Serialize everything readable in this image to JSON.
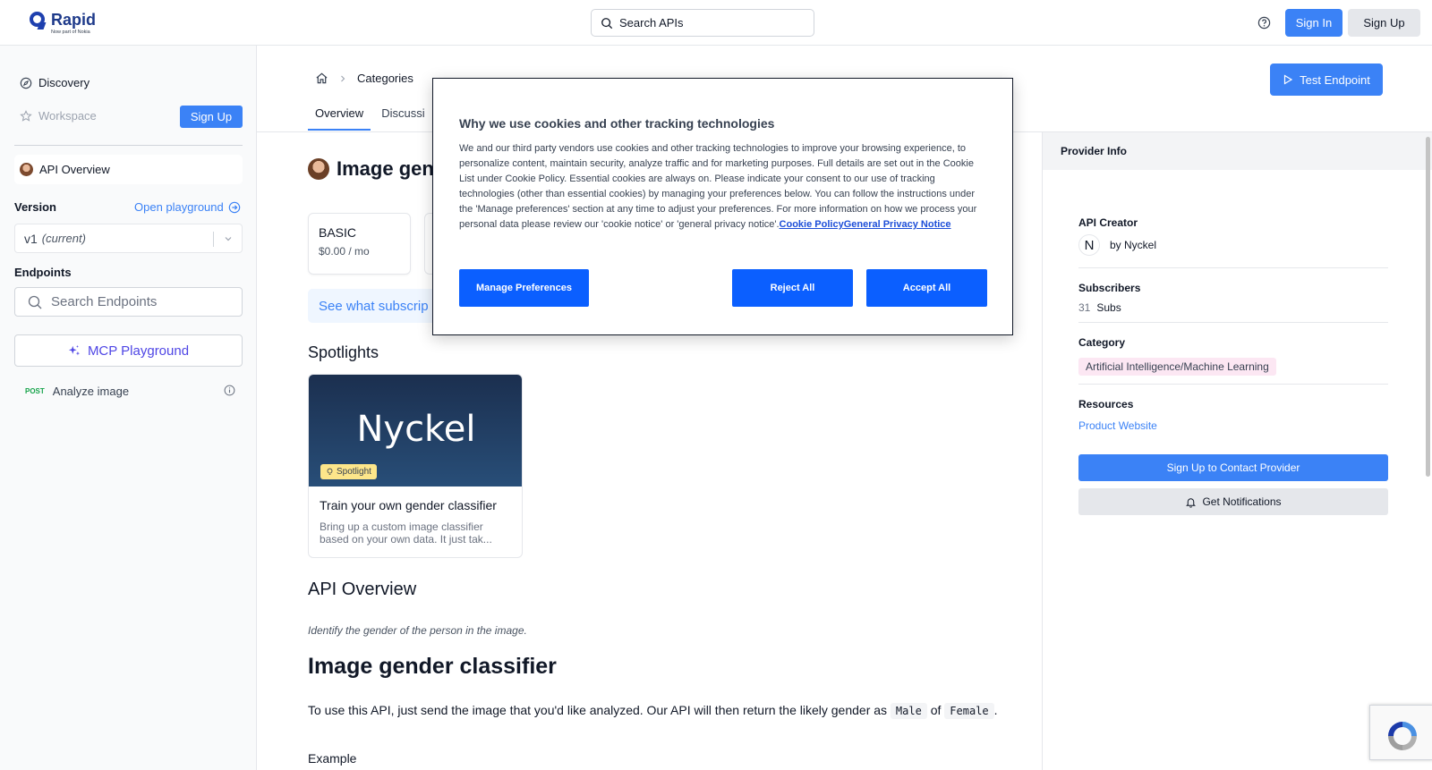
{
  "header": {
    "logo_name": "Rapid",
    "logo_sub": "Now part of Nokia",
    "search_placeholder": "Search APIs",
    "sign_in": "Sign In",
    "sign_up": "Sign Up"
  },
  "sidebar": {
    "discovery": "Discovery",
    "workspace": "Workspace",
    "sign_up": "Sign Up",
    "api_overview": "API Overview",
    "version_label": "Version",
    "open_playground": "Open playground",
    "version_value": "v1",
    "version_note": "(current)",
    "endpoints_label": "Endpoints",
    "endpoint_search_placeholder": "Search Endpoints",
    "mcp_playground": "MCP Playground",
    "endpoints": [
      {
        "method": "POST",
        "name": "Analyze image"
      }
    ]
  },
  "main": {
    "breadcrumb": [
      "Categories"
    ],
    "tabs": [
      "Overview",
      "Discussi"
    ],
    "test_endpoint": "Test Endpoint",
    "api_title": "Image gen",
    "plan": {
      "name": "BASIC",
      "price": "$0.00 / mo"
    },
    "subscription_banner": "See what subscrip",
    "spotlights_heading": "Spotlights",
    "spotlight": {
      "logo_text": "Nyckel",
      "badge": "Spotlight",
      "title": "Train your own gender classifier",
      "desc": "Bring up a custom image classifier based on your own data. It just tak..."
    },
    "overview_heading": "API Overview",
    "overview_desc": "Identify the gender of the person in the image.",
    "classifier_heading": "Image gender classifier",
    "usage_prefix": "To use this API, just send the image that you'd like analyzed. Our API will then return the likely gender as",
    "usage_male": "Male",
    "usage_of": "of",
    "usage_female": "Female",
    "usage_suffix": ".",
    "example_label": "Example"
  },
  "provider": {
    "header": "Provider Info",
    "api_creator_label": "API Creator",
    "creator_initial": "N",
    "creator_name": "by Nyckel",
    "subscribers_label": "Subscribers",
    "subscribers_count": "31",
    "subscribers_unit": "Subs",
    "category_label": "Category",
    "category_value": "Artificial Intelligence/Machine Learning",
    "resources_label": "Resources",
    "product_website": "Product Website",
    "contact_button": "Sign Up to Contact Provider",
    "notifications_button": "Get Notifications"
  },
  "cookie": {
    "title": "Why we use cookies and other tracking technologies",
    "body": "We and our third party vendors use cookies and other tracking technologies to improve your browsing experience, to personalize content, maintain security, analyze traffic and for marketing purposes. Full details are set out in the Cookie List under Cookie Policy. Essential cookies are always on. Please indicate your consent to our use of tracking technologies (other than essential cookies) by managing your preferences below. You can follow the instructions under the 'Manage preferences' section at any time to adjust your preferences. For more information on how we process your personal data please review our 'cookie notice' or 'general privacy notice'.",
    "link1": "Cookie Policy",
    "link2": "General Privacy Notice",
    "manage": "Manage Preferences",
    "reject": "Reject All",
    "accept": "Accept All"
  },
  "colors": {
    "accent": "#3b82f6",
    "cookie_button": "#0b5fff",
    "logo": "#1e40af",
    "category_tag": "#fce7f3"
  }
}
